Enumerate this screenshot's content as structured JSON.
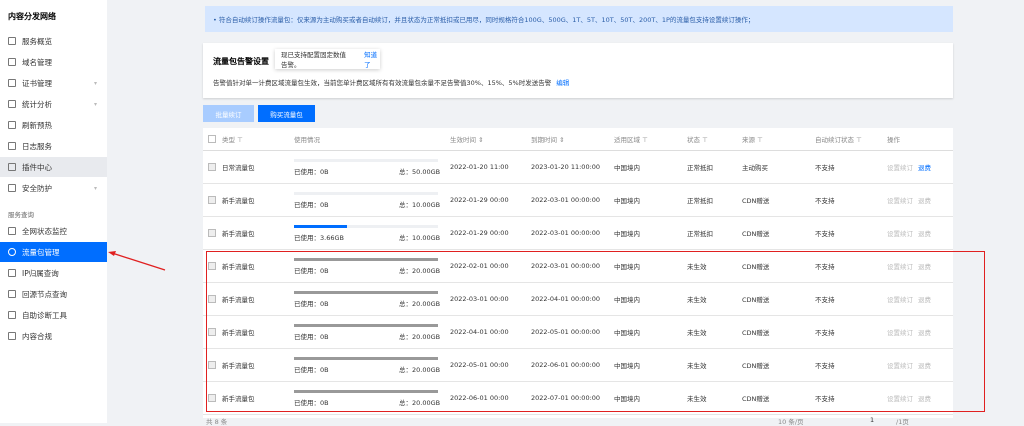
{
  "sidebar": {
    "brand": "内容分发网络",
    "items": [
      {
        "label": "服务概览",
        "icon": "grid-icon"
      },
      {
        "label": "域名管理",
        "icon": "domain-icon"
      },
      {
        "label": "证书管理",
        "icon": "certificate-icon",
        "chevron": true
      },
      {
        "label": "统计分析",
        "icon": "pie-chart-icon",
        "chevron": true
      },
      {
        "label": "刷新预热",
        "icon": "refresh-icon"
      },
      {
        "label": "日志服务",
        "icon": "folder-icon"
      },
      {
        "label": "插件中心",
        "icon": "plugin-icon"
      },
      {
        "label": "安全防护",
        "icon": "shield-icon",
        "chevron": true
      }
    ],
    "group": "服务查询",
    "items2": [
      {
        "label": "全网状态监控",
        "icon": "monitor-icon"
      },
      {
        "label": "流量包管理",
        "icon": "traffic-package-icon"
      },
      {
        "label": "IP归属查询",
        "icon": "ip-icon"
      },
      {
        "label": "回源节点查询",
        "icon": "search-node-icon"
      },
      {
        "label": "自助诊断工具",
        "icon": "diagnose-icon"
      },
      {
        "label": "内容合规",
        "icon": "image-icon"
      }
    ]
  },
  "banner": "• 符合自动续订操作流量包：仅来源为主动购买或者自动续订，并且状态为正常抵扣或已用尽，同时规格符合100G、500G、1T、5T、10T、50T、200T、1P的流量包支持设置续订操作；",
  "alarm": {
    "title": "流量包告警设置",
    "tooltip": "现已支持配置固定数值告警。",
    "tooltip_ok": "知道了",
    "desc": "告警值针对单一计费区域流量包生效，当前您单计费区域所有有效流量包余量不足告警值30%、15%、5%时发送告警",
    "edit": "编辑"
  },
  "toolbar": {
    "batch_renew": "批量续订",
    "buy": "购买流量包"
  },
  "table": {
    "headers": [
      "类型 ⊤",
      "使用情况",
      "生效时间 ⇕",
      "到期时间 ⇕",
      "适用区域 ⊤",
      "状态 ⊤",
      "来源 ⊤",
      "自动续订状态 ⊤",
      "操作"
    ],
    "rows": [
      {
        "type": "日常流量包",
        "used": "已使用：0B",
        "total": "总：50.00GB",
        "pct": 0,
        "start": "2022-01-20 11:00",
        "end": "2023-01-20 11:00:00",
        "region": "中国境内",
        "status": "正常抵扣",
        "source": "主动购买",
        "auto": "不支持",
        "op1": "设置续订",
        "op2": "退费",
        "op2active": true
      },
      {
        "type": "新手流量包",
        "used": "已使用：0B",
        "total": "总：10.00GB",
        "pct": 0,
        "start": "2022-01-29 00:00",
        "end": "2022-03-01 00:00:00",
        "region": "中国境内",
        "status": "正常抵扣",
        "source": "CDN赠送",
        "auto": "不支持",
        "op1": "设置续订",
        "op2": "退费"
      },
      {
        "type": "新手流量包",
        "used": "已使用：3.66GB",
        "total": "总：10.00GB",
        "pct": 36.6,
        "start": "2022-01-29 00:00",
        "end": "2022-03-01 00:00:00",
        "region": "中国境内",
        "status": "正常抵扣",
        "source": "CDN赠送",
        "auto": "不支持",
        "op1": "设置续订",
        "op2": "退费"
      },
      {
        "type": "新手流量包",
        "used": "已使用：0B",
        "total": "总：20.00GB",
        "pct": 100,
        "grey": true,
        "start": "2022-02-01 00:00",
        "end": "2022-03-01 00:00:00",
        "region": "中国境内",
        "status": "未生效",
        "source": "CDN赠送",
        "auto": "不支持",
        "op1": "设置续订",
        "op2": "退费"
      },
      {
        "type": "新手流量包",
        "used": "已使用：0B",
        "total": "总：20.00GB",
        "pct": 100,
        "grey": true,
        "start": "2022-03-01 00:00",
        "end": "2022-04-01 00:00:00",
        "region": "中国境内",
        "status": "未生效",
        "source": "CDN赠送",
        "auto": "不支持",
        "op1": "设置续订",
        "op2": "退费"
      },
      {
        "type": "新手流量包",
        "used": "已使用：0B",
        "total": "总：20.00GB",
        "pct": 100,
        "grey": true,
        "start": "2022-04-01 00:00",
        "end": "2022-05-01 00:00:00",
        "region": "中国境内",
        "status": "未生效",
        "source": "CDN赠送",
        "auto": "不支持",
        "op1": "设置续订",
        "op2": "退费"
      },
      {
        "type": "新手流量包",
        "used": "已使用：0B",
        "total": "总：20.00GB",
        "pct": 100,
        "grey": true,
        "start": "2022-05-01 00:00",
        "end": "2022-06-01 00:00:00",
        "region": "中国境内",
        "status": "未生效",
        "source": "CDN赠送",
        "auto": "不支持",
        "op1": "设置续订",
        "op2": "退费"
      },
      {
        "type": "新手流量包",
        "used": "已使用：0B",
        "total": "总：20.00GB",
        "pct": 100,
        "grey": true,
        "start": "2022-06-01 00:00",
        "end": "2022-07-01 00:00:00",
        "region": "中国境内",
        "status": "未生效",
        "source": "CDN赠送",
        "auto": "不支持",
        "op1": "设置续订",
        "op2": "退费"
      }
    ]
  },
  "footer": {
    "total": "共 8 条",
    "page_size": "10 条/页",
    "page": "1",
    "pages": "/1页"
  },
  "colors": {
    "accent": "#006eff",
    "highlight": "#e02020"
  }
}
